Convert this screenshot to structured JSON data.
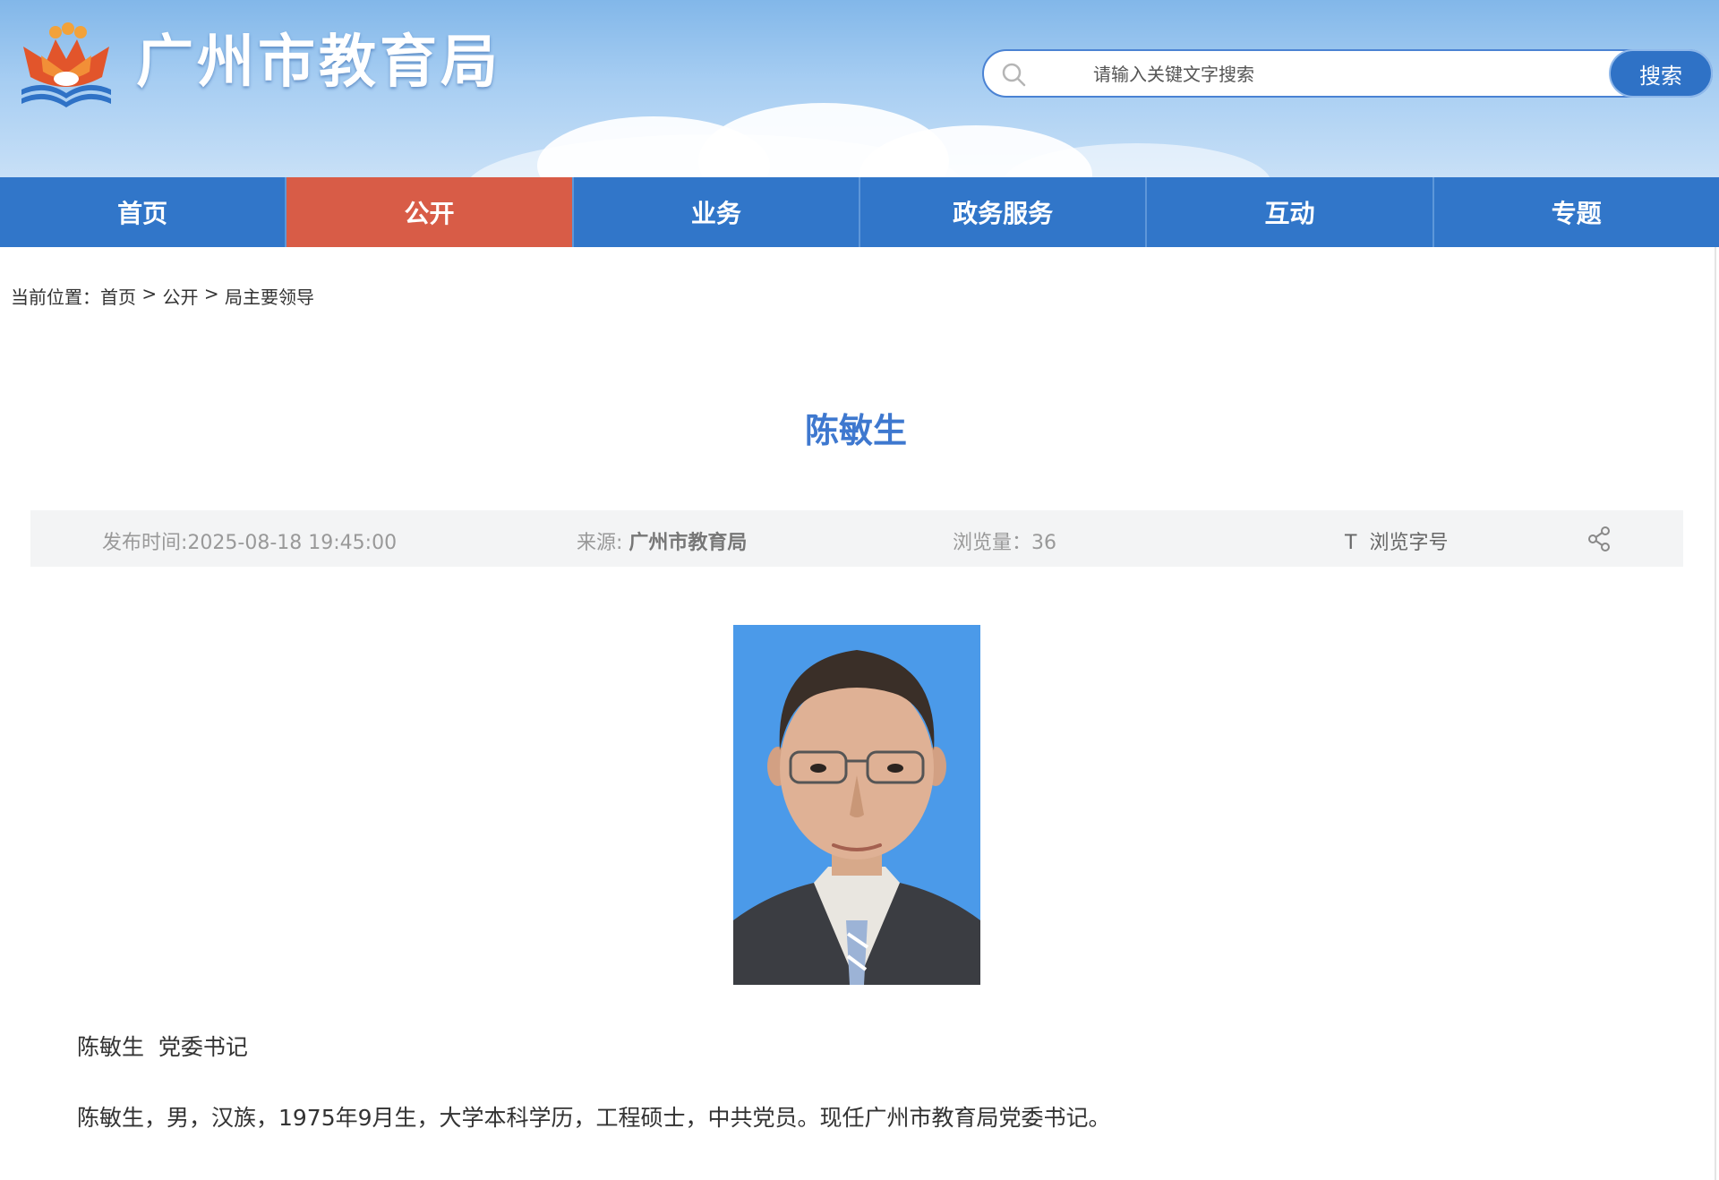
{
  "header": {
    "site_title": "广州市教育局",
    "search": {
      "placeholder": "请输入关键文字搜索",
      "button_label": "搜索"
    }
  },
  "nav": {
    "items": [
      {
        "label": "首页",
        "active": false
      },
      {
        "label": "公开",
        "active": true
      },
      {
        "label": "业务",
        "active": false
      },
      {
        "label": "政务服务",
        "active": false
      },
      {
        "label": "互动",
        "active": false
      },
      {
        "label": "专题",
        "active": false
      }
    ]
  },
  "breadcrumb": {
    "prefix": "当前位置：",
    "items": [
      "首页",
      "公开",
      "局主要领导"
    ],
    "separator": " > "
  },
  "article": {
    "title": "陈敏生",
    "meta": {
      "publish_time": "发布时间:2025-08-18 19:45:00",
      "source_label": "来源: ",
      "source_value": "广州市教育局",
      "views_label": "浏览量：",
      "views_value": "36",
      "font_size_icon": "T",
      "font_size_label": "浏览字号"
    },
    "caption": "陈敏生  党委书记",
    "bio": "陈敏生，男，汉族，1975年9月生，大学本科学历，工程硕士，中共党员。现任广州市教育局党委书记。"
  },
  "icons": {
    "logo": "education-bureau-logo",
    "search": "search-icon",
    "share": "share-icon"
  },
  "colors": {
    "nav_bg": "#3176c9",
    "nav_active": "#d85c47",
    "title": "#3e78cf",
    "search_button": "#2f72c6"
  }
}
